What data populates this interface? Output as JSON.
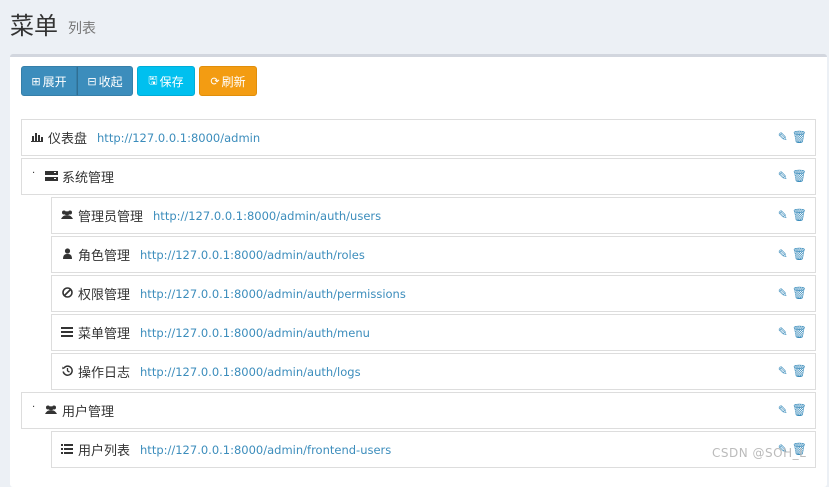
{
  "header": {
    "title": "菜单",
    "subtitle": "列表"
  },
  "toolbar": {
    "expand_label": "展开",
    "collapse_label": "收起",
    "save_label": "保存",
    "refresh_label": "刷新"
  },
  "menu": [
    {
      "label": "仪表盘",
      "url": "http://127.0.0.1:8000/admin",
      "icon": "bar-chart-icon"
    },
    {
      "label": "系统管理",
      "url": "",
      "icon": "server-icon"
    },
    {
      "label": "管理员管理",
      "url": "http://127.0.0.1:8000/admin/auth/users",
      "icon": "users-icon"
    },
    {
      "label": "角色管理",
      "url": "http://127.0.0.1:8000/admin/auth/roles",
      "icon": "user-icon"
    },
    {
      "label": "权限管理",
      "url": "http://127.0.0.1:8000/admin/auth/permissions",
      "icon": "ban-icon"
    },
    {
      "label": "菜单管理",
      "url": "http://127.0.0.1:8000/admin/auth/menu",
      "icon": "bars-icon"
    },
    {
      "label": "操作日志",
      "url": "http://127.0.0.1:8000/admin/auth/logs",
      "icon": "history-icon"
    },
    {
      "label": "用户管理",
      "url": "",
      "icon": "users-icon"
    },
    {
      "label": "用户列表",
      "url": "http://127.0.0.1:8000/admin/frontend-users",
      "icon": "list-icon"
    }
  ],
  "watermark": "CSDN @SOH_L"
}
